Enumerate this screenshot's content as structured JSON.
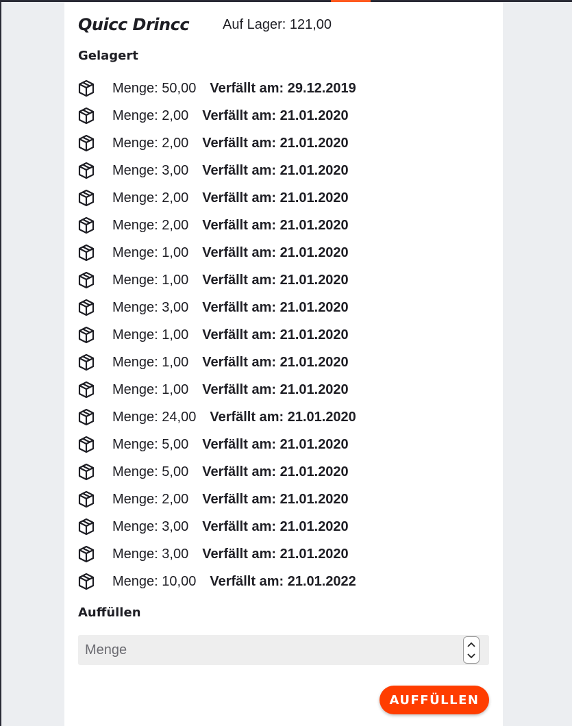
{
  "product": {
    "title": "Quicc Drincc",
    "stock": "Auf Lager: 121,00"
  },
  "stored": {
    "heading": "Gelagert",
    "items": [
      {
        "qty": "Menge: 50,00",
        "expires": "Verfällt am: 29.12.2019"
      },
      {
        "qty": "Menge: 2,00",
        "expires": "Verfällt am: 21.01.2020"
      },
      {
        "qty": "Menge: 2,00",
        "expires": "Verfällt am: 21.01.2020"
      },
      {
        "qty": "Menge: 3,00",
        "expires": "Verfällt am: 21.01.2020"
      },
      {
        "qty": "Menge: 2,00",
        "expires": "Verfällt am: 21.01.2020"
      },
      {
        "qty": "Menge: 2,00",
        "expires": "Verfällt am: 21.01.2020"
      },
      {
        "qty": "Menge: 1,00",
        "expires": "Verfällt am: 21.01.2020"
      },
      {
        "qty": "Menge: 1,00",
        "expires": "Verfällt am: 21.01.2020"
      },
      {
        "qty": "Menge: 3,00",
        "expires": "Verfällt am: 21.01.2020"
      },
      {
        "qty": "Menge: 1,00",
        "expires": "Verfällt am: 21.01.2020"
      },
      {
        "qty": "Menge: 1,00",
        "expires": "Verfällt am: 21.01.2020"
      },
      {
        "qty": "Menge: 1,00",
        "expires": "Verfällt am: 21.01.2020"
      },
      {
        "qty": "Menge: 24,00",
        "expires": "Verfällt am: 21.01.2020"
      },
      {
        "qty": "Menge: 5,00",
        "expires": "Verfällt am: 21.01.2020"
      },
      {
        "qty": "Menge: 5,00",
        "expires": "Verfällt am: 21.01.2020"
      },
      {
        "qty": "Menge: 2,00",
        "expires": "Verfällt am: 21.01.2020"
      },
      {
        "qty": "Menge: 3,00",
        "expires": "Verfällt am: 21.01.2020"
      },
      {
        "qty": "Menge: 3,00",
        "expires": "Verfällt am: 21.01.2020"
      },
      {
        "qty": "Menge: 10,00",
        "expires": "Verfällt am: 21.01.2022"
      }
    ],
    "item_icon": "package-box-icon"
  },
  "refill": {
    "heading": "Auffüllen",
    "input_placeholder": "Menge",
    "input_value": "",
    "button_label": "AUFFÜLLEN"
  },
  "colors": {
    "accent": "#ff3d00",
    "topbar": "#2a2b36",
    "background": "#eceef1",
    "input_bg": "#eeeeee"
  }
}
